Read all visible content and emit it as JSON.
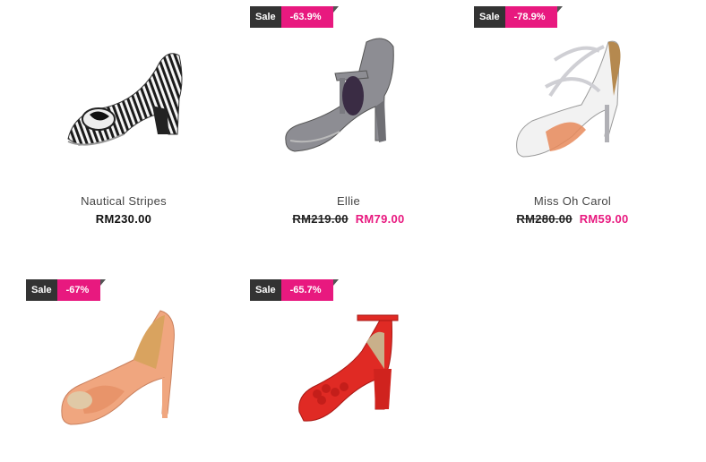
{
  "products": [
    {
      "name": "Nautical Stripes",
      "price": "RM230.00"
    },
    {
      "name": "Ellie",
      "old_price": "RM219.00",
      "new_price": "RM79.00",
      "sale_label": "Sale",
      "discount": "-63.9%"
    },
    {
      "name": "Miss Oh Carol",
      "old_price": "RM280.00",
      "new_price": "RM59.00",
      "sale_label": "Sale",
      "discount": "-78.9%"
    },
    {
      "sale_label": "Sale",
      "discount": "-67%"
    },
    {
      "sale_label": "Sale",
      "discount": "-65.7%"
    }
  ],
  "colors": {
    "sale_badge": "#333333",
    "discount_badge": "#e8197f",
    "sale_price": "#e8197f"
  }
}
